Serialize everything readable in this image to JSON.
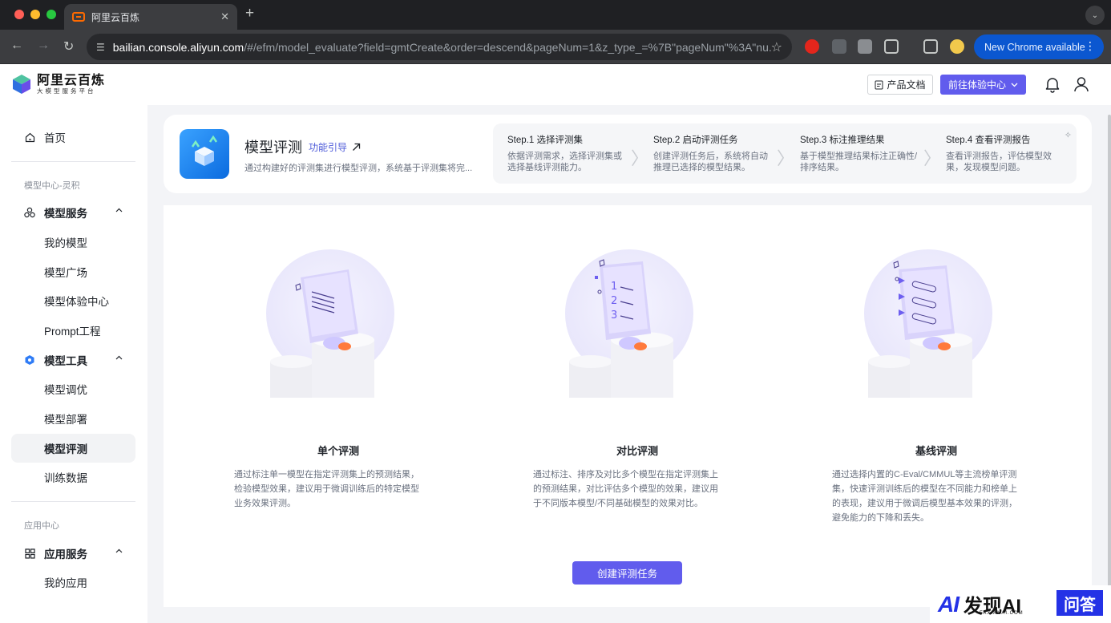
{
  "browser": {
    "tab_title": "阿里云百炼",
    "url_host": "bailian.console.aliyun.com",
    "url_path": "/#/efm/model_evaluate?field=gmtCreate&order=descend&pageNum=1&z_type_=%7B\"pageNum\"%3A\"nu...",
    "new_chrome_label": "New Chrome available"
  },
  "header": {
    "logo_name": "阿里云百炼",
    "logo_sub": "大模型服务平台",
    "doc_button": "产品文档",
    "experience_button": "前往体验中心"
  },
  "sidebar": {
    "home": "首页",
    "group1_label": "模型中心-灵积",
    "model_service": "模型服务",
    "my_models": "我的模型",
    "model_square": "模型广场",
    "model_experience": "模型体验中心",
    "prompt_engineering": "Prompt工程",
    "model_tools": "模型工具",
    "model_tuning": "模型调优",
    "model_deploy": "模型部署",
    "model_evaluate": "模型评测",
    "training_data": "训练数据",
    "group2_label": "应用中心",
    "app_service": "应用服务",
    "my_apps": "我的应用"
  },
  "hero": {
    "title": "模型评测",
    "guide_link": "功能引导",
    "description": "通过构建好的评测集进行模型评测，系统基于评测集将完...",
    "steps": [
      {
        "title": "Step.1 选择评测集",
        "desc": "依据评测需求，选择评测集或选择基线评测能力。"
      },
      {
        "title": "Step.2 启动评测任务",
        "desc": "创建评测任务后，系统将自动推理已选择的模型结果。"
      },
      {
        "title": "Step.3 标注推理结果",
        "desc": "基于模型推理结果标注正确性/排序结果。"
      },
      {
        "title": "Step.4 查看评测报告",
        "desc": "查看评测报告，评估模型效果，发现模型问题。"
      }
    ]
  },
  "cards": [
    {
      "title": "单个评测",
      "desc": "通过标注单一模型在指定评测集上的预测结果，检验模型效果，建议用于微调训练后的特定模型业务效果评测。"
    },
    {
      "title": "对比评测",
      "desc": "通过标注、排序及对比多个模型在指定评测集上的预测结果，对比评估多个模型的效果，建议用于不同版本模型/不同基础模型的效果对比。"
    },
    {
      "title": "基线评测",
      "desc": "通过选择内置的C-Eval/CMMUL等主流榜单评测集，快速评测训练后的模型在不同能力和榜单上的表现，建议用于微调后模型基本效果的评测，避免能力的下降和丢失。"
    }
  ],
  "create_button": "创建评测任务",
  "watermark": {
    "ai": "AI",
    "cn": "发现AI",
    "en": "FAXIANAI.COM",
    "box": "问答"
  },
  "colors": {
    "accent": "#615ced",
    "link": "#4e5bd9",
    "bg": "#f3f4f7"
  }
}
